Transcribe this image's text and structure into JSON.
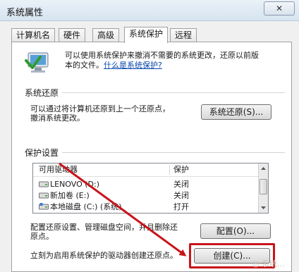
{
  "window": {
    "title": "系统属性",
    "close_glyph": "✕"
  },
  "tabs": [
    {
      "label": "计算机名"
    },
    {
      "label": "硬件"
    },
    {
      "label": "高级"
    },
    {
      "label": "系统保护",
      "active": true
    },
    {
      "label": "远程"
    }
  ],
  "intro": {
    "line1": "可以使用系统保护来撤消不需要的系统更改，还原以前版",
    "line2_prefix": "本的文件。",
    "link": "什么是系统保护?"
  },
  "restore_section": {
    "label": "系统还原",
    "line1": "可以通过将计算机还原到上一个还原点，",
    "line2": "撤消系统更改。",
    "button": "系统还原(S)..."
  },
  "protection_section": {
    "label": "保护设置",
    "columns": [
      "可用驱动器",
      "保护"
    ],
    "drives": [
      {
        "name": "LENOVO (D:)",
        "status": "关闭"
      },
      {
        "name": "新加卷 (E:)",
        "status": "关闭"
      },
      {
        "name": "本地磁盘 (C:) (系统)",
        "status": "打开"
      }
    ],
    "configure_line1": "配置还原设置、管理磁盘空间，并且删除还",
    "configure_line2": "原点。",
    "configure_button": "配置(O)...",
    "create_line": "立刻为启用系统保护的驱动器创建还原点。",
    "create_button": "创建(C)..."
  },
  "watermark": "◎ 系统…",
  "colors": {
    "highlight": "#c8141b",
    "link": "#0645ad"
  }
}
